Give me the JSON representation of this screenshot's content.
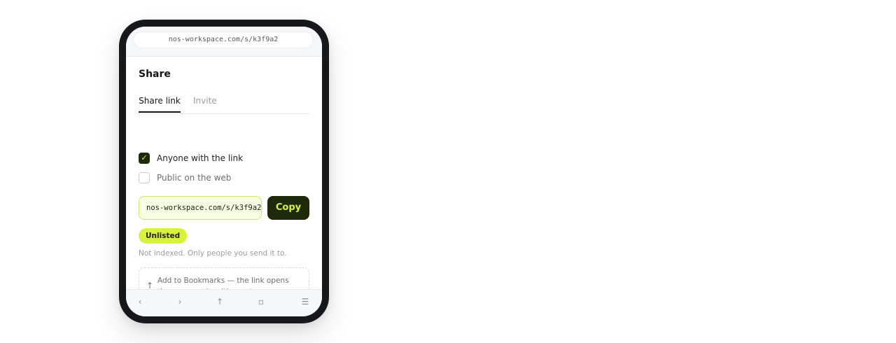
{
  "browser": {
    "url": "nos-workspace.com/s/k3f9a2"
  },
  "share": {
    "title": "Share",
    "tabs": [
      {
        "label": "Share link",
        "active": true
      },
      {
        "label": "Invite",
        "active": false
      }
    ],
    "options": [
      {
        "label": "Anyone with the link",
        "checked": true
      },
      {
        "label": "Public on the web",
        "checked": false
      }
    ],
    "check_glyph": "✓",
    "link_value": "nos-workspace.com/s/k3f9a2",
    "copy_label": "Copy",
    "badge": "Unlisted",
    "hint": "Not indexed. Only people you send it to.",
    "tip": {
      "icon": "↑",
      "text": "Add to Bookmarks — the link opens the page again with one tap."
    }
  },
  "bottom_nav": {
    "back": "‹",
    "forward": "›",
    "share": "↑",
    "tabs": "▫",
    "menu": "☰"
  },
  "colors": {
    "accent": "#d8f23a",
    "dark_accent": "#1f2a0a",
    "input_bg": "#f6fde0",
    "frame": "#16181c"
  },
  "icons": {
    "check": "check-icon",
    "share_up": "share-arrow-icon",
    "back": "chevron-left-icon",
    "forward": "chevron-right-icon",
    "tabs": "tabs-icon",
    "menu": "menu-icon"
  }
}
